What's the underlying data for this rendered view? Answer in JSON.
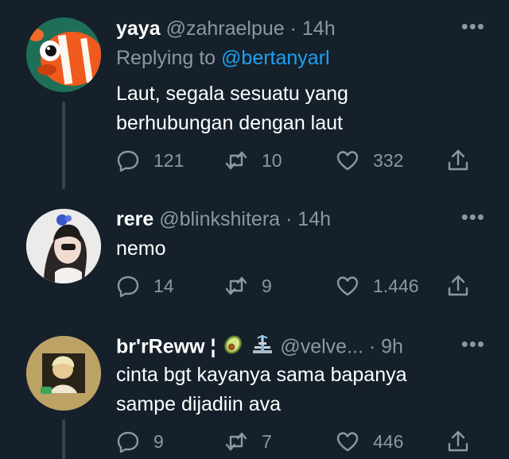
{
  "tweets": [
    {
      "name": "yaya",
      "handle": "@zahraelpue",
      "separator": "·",
      "time": "14h",
      "replying_prefix": "Replying to",
      "replying_to": "@bertanyarl",
      "text_lines": [
        "Laut, segala sesuatu yang",
        "berhubungan dengan laut"
      ],
      "replies": "121",
      "retweets": "10",
      "likes": "332"
    },
    {
      "name": "rere",
      "handle": "@blinkshitera",
      "separator": "·",
      "time": "14h",
      "text_lines": [
        "nemo"
      ],
      "replies": "14",
      "retweets": "9",
      "likes": "1.446"
    },
    {
      "name": "br'rReww ¦",
      "handle": "@velve...",
      "separator": "·",
      "time": "9h",
      "text_lines": [
        "cinta bgt kayanya sama bapanya",
        "sampe dijadiin ava"
      ],
      "replies": "9",
      "retweets": "7",
      "likes": "446"
    }
  ],
  "more_label": "•••",
  "colors": {
    "background": "#15202b",
    "secondary_text": "#8899a6",
    "link": "#1da1f2",
    "thread_line": "#38444d"
  },
  "icons": [
    "reply-icon",
    "retweet-icon",
    "like-icon",
    "share-icon",
    "avocado-emoji",
    "fountain-emoji"
  ]
}
